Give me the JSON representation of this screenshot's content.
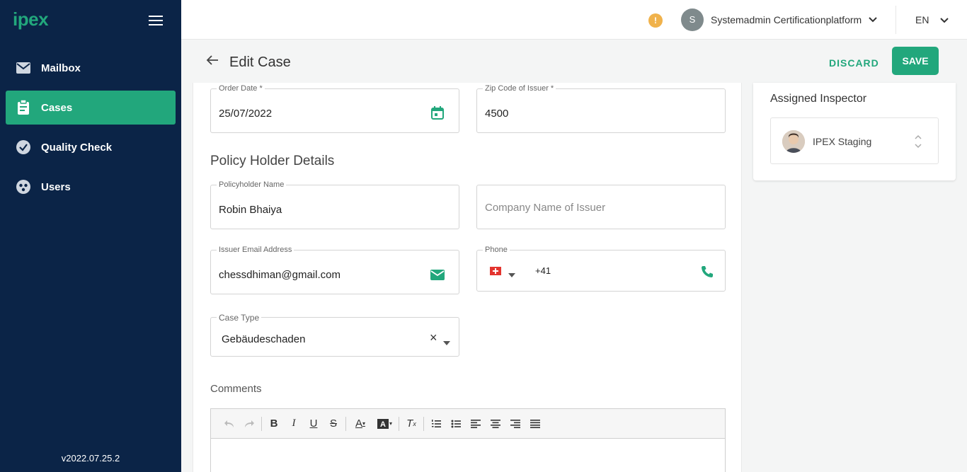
{
  "sidebar": {
    "logo": "ipex",
    "items": [
      {
        "label": "Mailbox",
        "icon": "mail-icon"
      },
      {
        "label": "Cases",
        "icon": "clipboard-icon",
        "active": true
      },
      {
        "label": "Quality Check",
        "icon": "check-circle-icon"
      },
      {
        "label": "Users",
        "icon": "users-icon"
      }
    ],
    "version": "v2022.07.25.2"
  },
  "header": {
    "avatar_initial": "S",
    "user_name": "Systemadmin Certificationplatform",
    "language": "EN",
    "warning_glyph": "!"
  },
  "editbar": {
    "title": "Edit Case",
    "discard_label": "DISCARD",
    "save_label": "SAVE"
  },
  "form": {
    "order_date": {
      "label": "Order Date *",
      "value": "25/07/2022"
    },
    "zip_code": {
      "label": "Zip Code of Issuer *",
      "value": "4500"
    },
    "section_title": "Policy Holder Details",
    "policyholder_name": {
      "label": "Policyholder Name",
      "value": "Robin Bhaiya"
    },
    "company_name": {
      "placeholder": "Company Name of Issuer"
    },
    "issuer_email": {
      "label": "Issuer Email Address",
      "value": "chessdhiman@gmail.com"
    },
    "phone": {
      "label": "Phone",
      "value": "+41",
      "country": "CH"
    },
    "case_type": {
      "label": "Case Type",
      "value": "Gebäudeschaden",
      "clear_glyph": "×"
    },
    "comments_label": "Comments"
  },
  "inspector": {
    "title": "Assigned Inspector",
    "name": "IPEX Staging"
  },
  "colors": {
    "sidebar_bg": "#0b2447",
    "accent": "#22a77c",
    "warning": "#f0b24b"
  }
}
